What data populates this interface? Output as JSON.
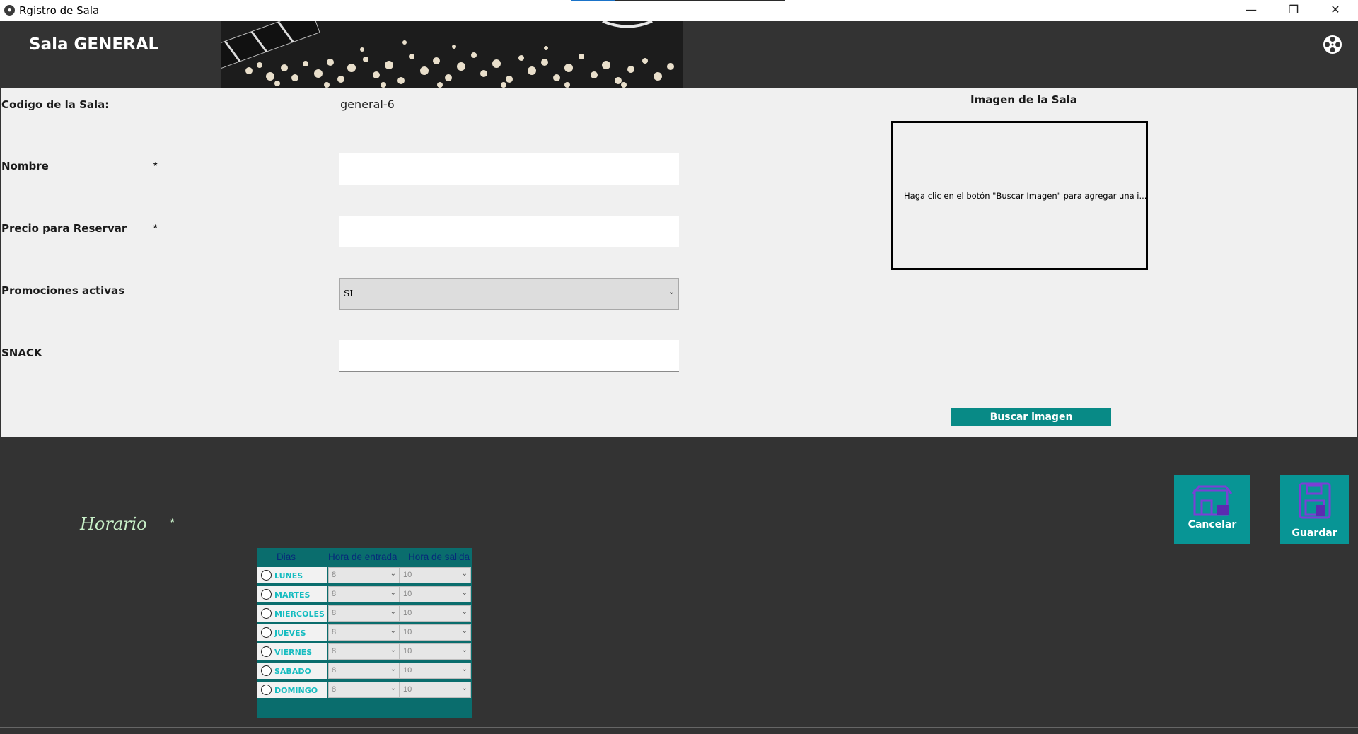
{
  "window": {
    "title": "Rgistro de Sala",
    "minimize": "—",
    "maximize": "❐",
    "close": "✕"
  },
  "header": {
    "title": "Sala GENERAL"
  },
  "form": {
    "codigo_label": "Codigo de la Sala:",
    "codigo_value": "general-6",
    "nombre_label": "Nombre",
    "nombre_value": "",
    "precio_label": "Precio para Reservar",
    "precio_value": "",
    "promociones_label": "Promociones activas",
    "promociones_value": "SI",
    "snack_label": "SNACK",
    "snack_value": "",
    "required_mark": "*"
  },
  "image_panel": {
    "title": "Imagen de la Sala",
    "hint": "Haga clic en el botón \"Buscar Imagen\" para agregar una i...",
    "button": "Buscar imagen"
  },
  "schedule": {
    "title": "Horario",
    "required_mark": "*",
    "headers": [
      "Dias",
      "Hora de entrada",
      "Hora de salida"
    ],
    "rows": [
      {
        "day": "LUNES",
        "entrada": "8",
        "salida": "10"
      },
      {
        "day": "MARTES",
        "entrada": "8",
        "salida": "10"
      },
      {
        "day": "MIERCOLES",
        "entrada": "8",
        "salida": "10"
      },
      {
        "day": "JUEVES",
        "entrada": "8",
        "salida": "10"
      },
      {
        "day": "VIERNES",
        "entrada": "8",
        "salida": "10"
      },
      {
        "day": "SABADO",
        "entrada": "8",
        "salida": "10"
      },
      {
        "day": "DOMINGO",
        "entrada": "8",
        "salida": "10"
      }
    ]
  },
  "actions": {
    "cancel": "Cancelar",
    "save": "Guardar"
  },
  "colors": {
    "accent": "#088a86",
    "dark": "#333333",
    "panel": "#f0f0f0"
  }
}
